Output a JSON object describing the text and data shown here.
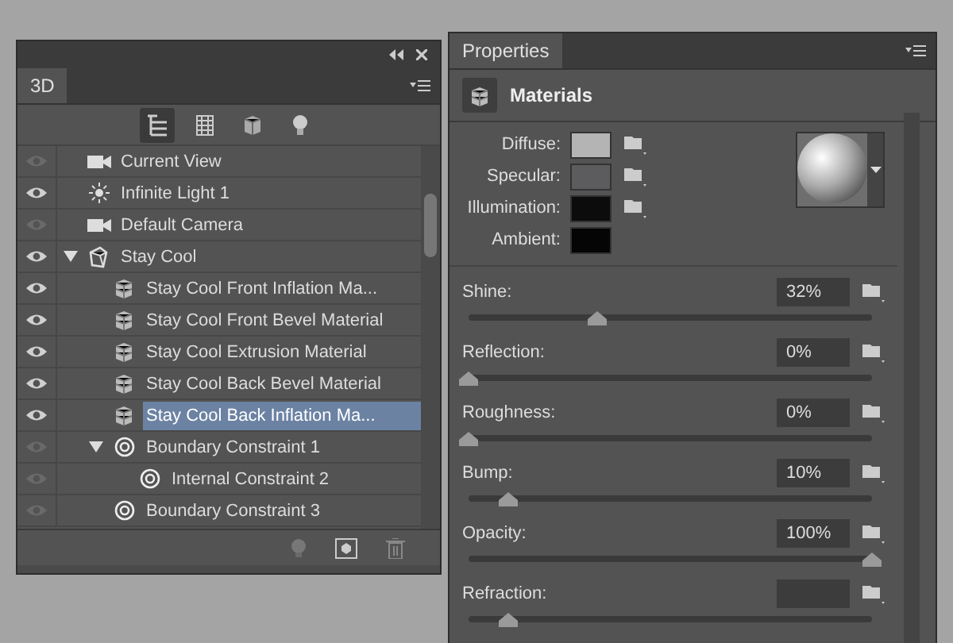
{
  "panel3d": {
    "tab": "3D",
    "filters": [
      {
        "kind": "scene",
        "selected": true
      },
      {
        "kind": "mesh",
        "selected": false
      },
      {
        "kind": "material",
        "selected": false
      },
      {
        "kind": "light",
        "selected": false
      }
    ],
    "layers": [
      {
        "name": "Current View",
        "kind": "camera",
        "visible": false,
        "selected": false
      },
      {
        "name": "Infinite Light 1",
        "kind": "light",
        "visible": true,
        "selected": false
      },
      {
        "name": "Default Camera",
        "kind": "camera",
        "visible": false,
        "selected": false
      },
      {
        "name": "Stay  Cool",
        "kind": "mesh",
        "visible": true,
        "selected": false,
        "expanded": true,
        "children": [
          {
            "name": "Stay  Cool Front Inflation Ma...",
            "kind": "material",
            "visible": true,
            "selected": false
          },
          {
            "name": "Stay  Cool Front Bevel Material",
            "kind": "material",
            "visible": true,
            "selected": false
          },
          {
            "name": "Stay  Cool Extrusion Material",
            "kind": "material",
            "visible": true,
            "selected": false
          },
          {
            "name": "Stay  Cool Back Bevel Material",
            "kind": "material",
            "visible": true,
            "selected": false
          },
          {
            "name": "Stay  Cool Back Inflation Ma...",
            "kind": "material",
            "visible": true,
            "selected": true
          },
          {
            "name": "Boundary Constraint 1",
            "kind": "constraint",
            "visible": false,
            "selected": false,
            "expanded": true,
            "children": [
              {
                "name": "Internal Constraint 2",
                "kind": "constraint",
                "visible": false,
                "selected": false
              }
            ]
          },
          {
            "name": "Boundary Constraint 3",
            "kind": "constraint",
            "visible": false,
            "selected": false
          }
        ]
      }
    ]
  },
  "properties": {
    "tab": "Properties",
    "section": "Materials",
    "swatches": [
      {
        "label": "Diffuse:",
        "color": "#b4b4b4",
        "folder": true
      },
      {
        "label": "Specular:",
        "color": "#5c5c5e",
        "folder": true
      },
      {
        "label": "Illumination:",
        "color": "#0c0c0c",
        "folder": true
      },
      {
        "label": "Ambient:",
        "color": "#050505",
        "folder": false
      }
    ],
    "sliders": [
      {
        "label": "Shine:",
        "value": "32%",
        "level": 0.32
      },
      {
        "label": "Reflection:",
        "value": "0%",
        "level": 0
      },
      {
        "label": "Roughness:",
        "value": "0%",
        "level": 0
      },
      {
        "label": "Bump:",
        "value": "10%",
        "level": 0.1
      },
      {
        "label": "Opacity:",
        "value": "100%",
        "level": 1
      },
      {
        "label": "Refraction:",
        "level": 0.1
      }
    ]
  }
}
